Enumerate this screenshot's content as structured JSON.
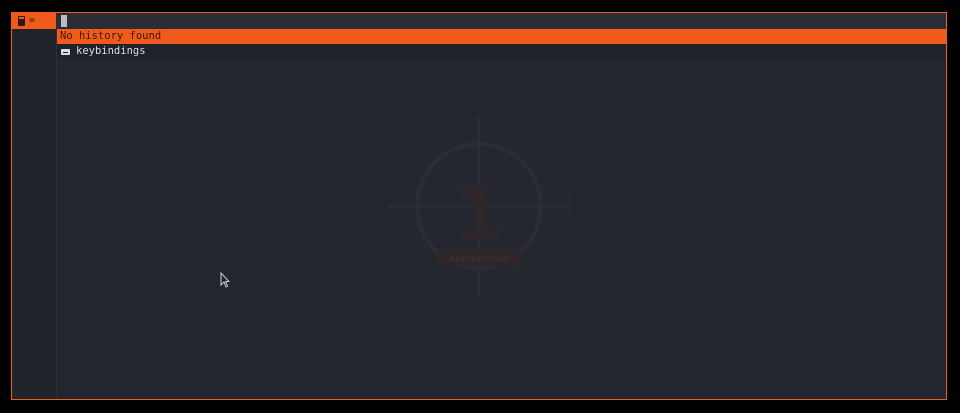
{
  "prompt": {
    "symbol": "=",
    "icon": "calculator-icon",
    "input_value": ""
  },
  "results": [
    {
      "label": "No history found",
      "selected": true
    },
    {
      "label": "keybindings",
      "icon": "keyboard-icon",
      "selected": false
    }
  ],
  "watermark": {
    "number": "1",
    "label": "Abandonner"
  },
  "colors": {
    "accent": "#f05a1a",
    "background": "#23262e",
    "text": "#d8dbe0"
  }
}
